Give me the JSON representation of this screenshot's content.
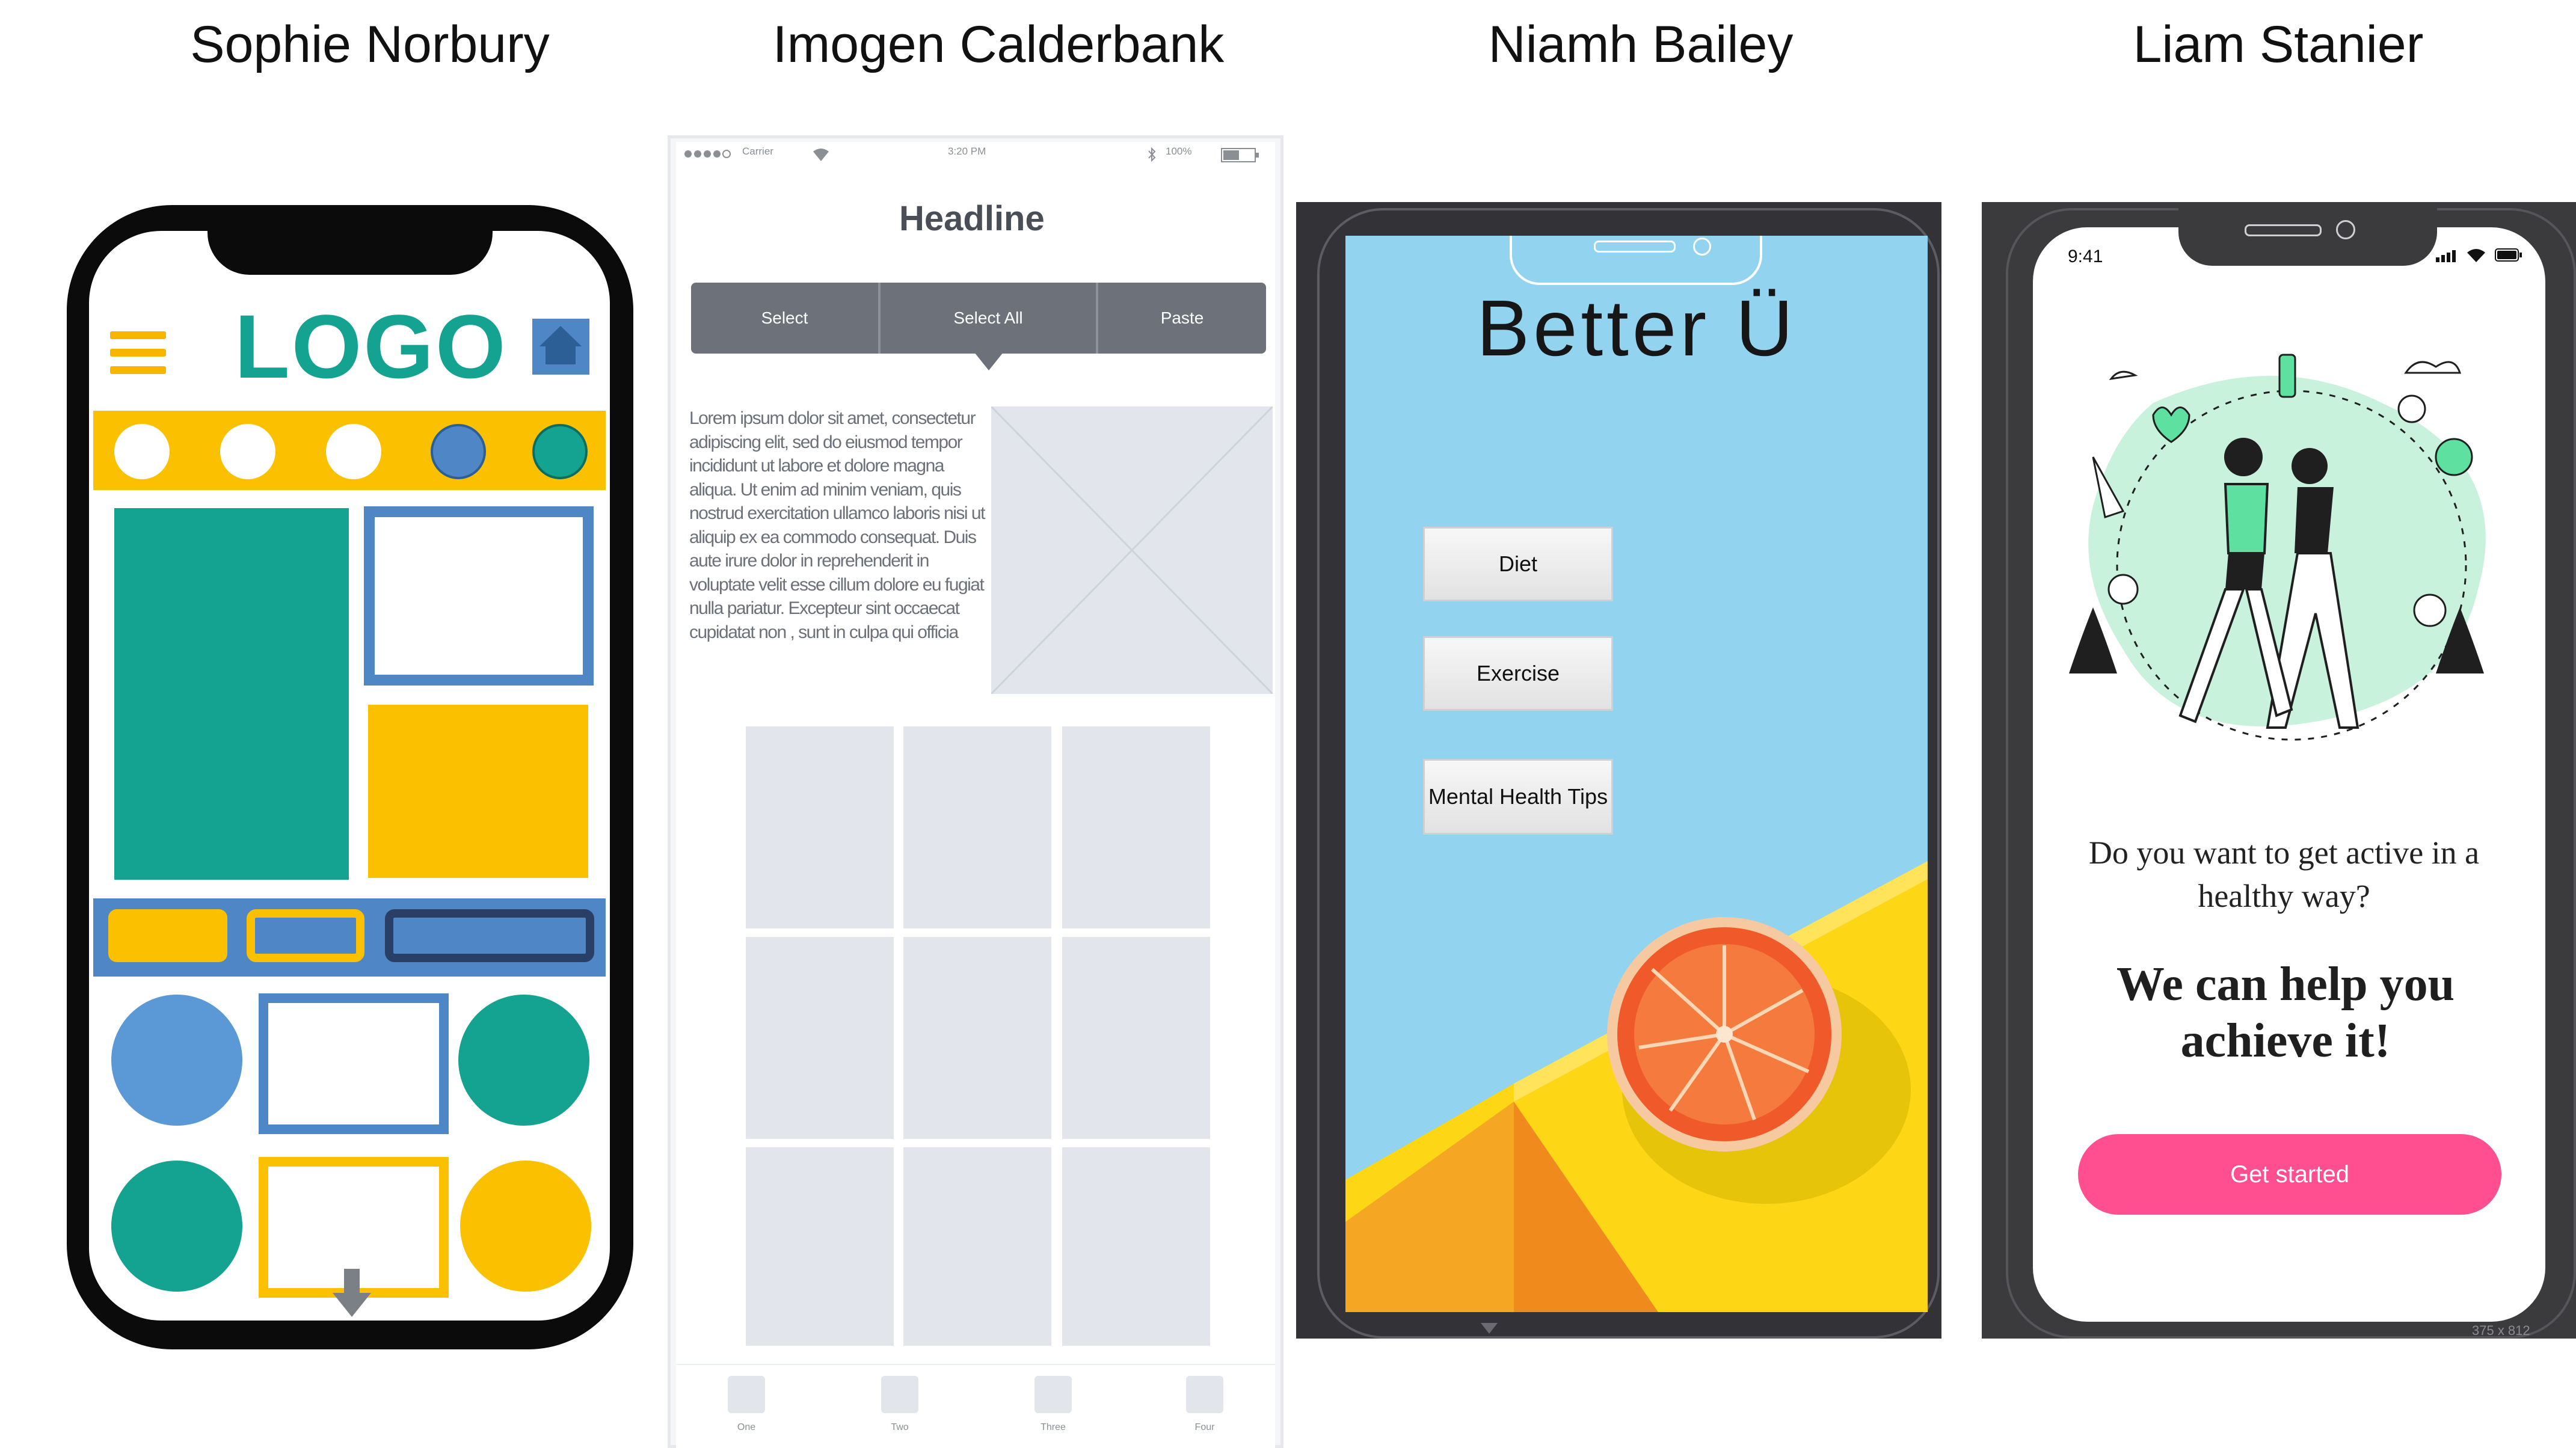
{
  "names": {
    "p1": "Sophie Norbury",
    "p2": "Imogen Calderbank",
    "p3": "Niamh Bailey",
    "p4": "Liam Stanier"
  },
  "sophie": {
    "logo": "LOGO",
    "colors": {
      "teal": "#14a391",
      "yellow": "#fbc000",
      "blue": "#4f86c6",
      "black": "#0b0b0b"
    }
  },
  "imogen": {
    "status": {
      "carrier": "Carrier",
      "time": "3:20 PM",
      "battery": "100%"
    },
    "headline": "Headline",
    "toolbar": {
      "select": "Select",
      "select_all": "Select All",
      "paste": "Paste"
    },
    "lorem": "Lorem ipsum dolor sit amet, consectetur adipiscing elit, sed do eiusmod tempor incididunt ut labore et dolore magna aliqua. Ut enim ad minim veniam, quis nostrud exercitation ullamco laboris nisi ut aliquip ex ea commodo consequat. Duis aute irure dolor in reprehenderit in voluptate velit esse cillum dolore eu fugiat nulla pariatur. Excepteur sint occaecat cupidatat non , sunt in culpa qui officia",
    "tabs": [
      "One",
      "Two",
      "Three",
      "Four"
    ]
  },
  "niamh": {
    "title": "Better Ü",
    "buttons": {
      "diet": "Diet",
      "exercise": "Exercise",
      "mental": "Mental Health Tips"
    },
    "colors": {
      "sky": "#92d3ef",
      "yellow": "#fdd616",
      "orange": "#f08a1c"
    }
  },
  "liam": {
    "time": "9:41",
    "question": "Do you want to get active in a healthy way?",
    "headline": "We can help you achieve it!",
    "cta": "Get started",
    "dimension": "375 x 812",
    "colors": {
      "accent": "#ff4f91",
      "mint": "#c9f2dd"
    }
  }
}
